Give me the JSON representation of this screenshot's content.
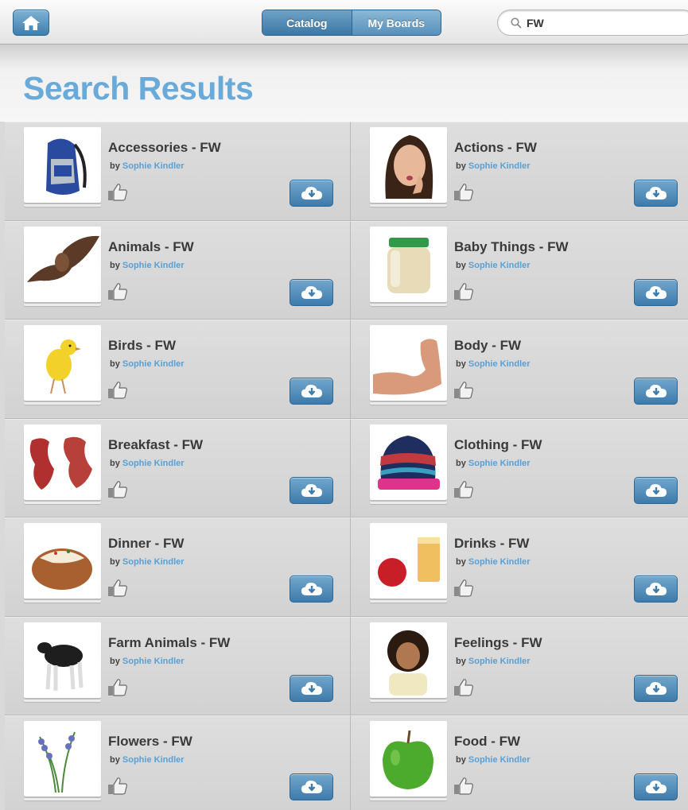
{
  "toolbar": {
    "tabs": [
      {
        "label": "Catalog",
        "selected": true
      },
      {
        "label": "My Boards",
        "selected": false
      }
    ],
    "search_value": "FW",
    "icons": {
      "home": "home-icon",
      "search": "search-icon"
    }
  },
  "page_title": "Search Results",
  "results": [
    {
      "title": "Accessories - FW",
      "by": "by",
      "author": "Sophie Kindler",
      "thumb": "backpack"
    },
    {
      "title": "Actions - FW",
      "by": "by",
      "author": "Sophie Kindler",
      "thumb": "woman-blowing-kiss"
    },
    {
      "title": "Animals - FW",
      "by": "by",
      "author": "Sophie Kindler",
      "thumb": "bat"
    },
    {
      "title": "Baby Things - FW",
      "by": "by",
      "author": "Sophie Kindler",
      "thumb": "baby-food-jar"
    },
    {
      "title": "Birds - FW",
      "by": "by",
      "author": "Sophie Kindler",
      "thumb": "canary"
    },
    {
      "title": "Body - FW",
      "by": "by",
      "author": "Sophie Kindler",
      "thumb": "flexed-arm"
    },
    {
      "title": "Breakfast - FW",
      "by": "by",
      "author": "Sophie Kindler",
      "thumb": "bacon"
    },
    {
      "title": "Clothing - FW",
      "by": "by",
      "author": "Sophie Kindler",
      "thumb": "striped-beanie"
    },
    {
      "title": "Dinner - FW",
      "by": "by",
      "author": "Sophie Kindler",
      "thumb": "baked-potato"
    },
    {
      "title": "Drinks - FW",
      "by": "by",
      "author": "Sophie Kindler",
      "thumb": "apple-and-juice"
    },
    {
      "title": "Farm Animals - FW",
      "by": "by",
      "author": "Sophie Kindler",
      "thumb": "calf"
    },
    {
      "title": "Feelings - FW",
      "by": "by",
      "author": "Sophie Kindler",
      "thumb": "grumpy-child"
    },
    {
      "title": "Flowers - FW",
      "by": "by",
      "author": "Sophie Kindler",
      "thumb": "bluebells"
    },
    {
      "title": "Food - FW",
      "by": "by",
      "author": "Sophie Kindler",
      "thumb": "green-apple"
    }
  ],
  "colors": {
    "accent": "#6aaad8",
    "author": "#5aa0d4",
    "button": "#3e7bab"
  }
}
